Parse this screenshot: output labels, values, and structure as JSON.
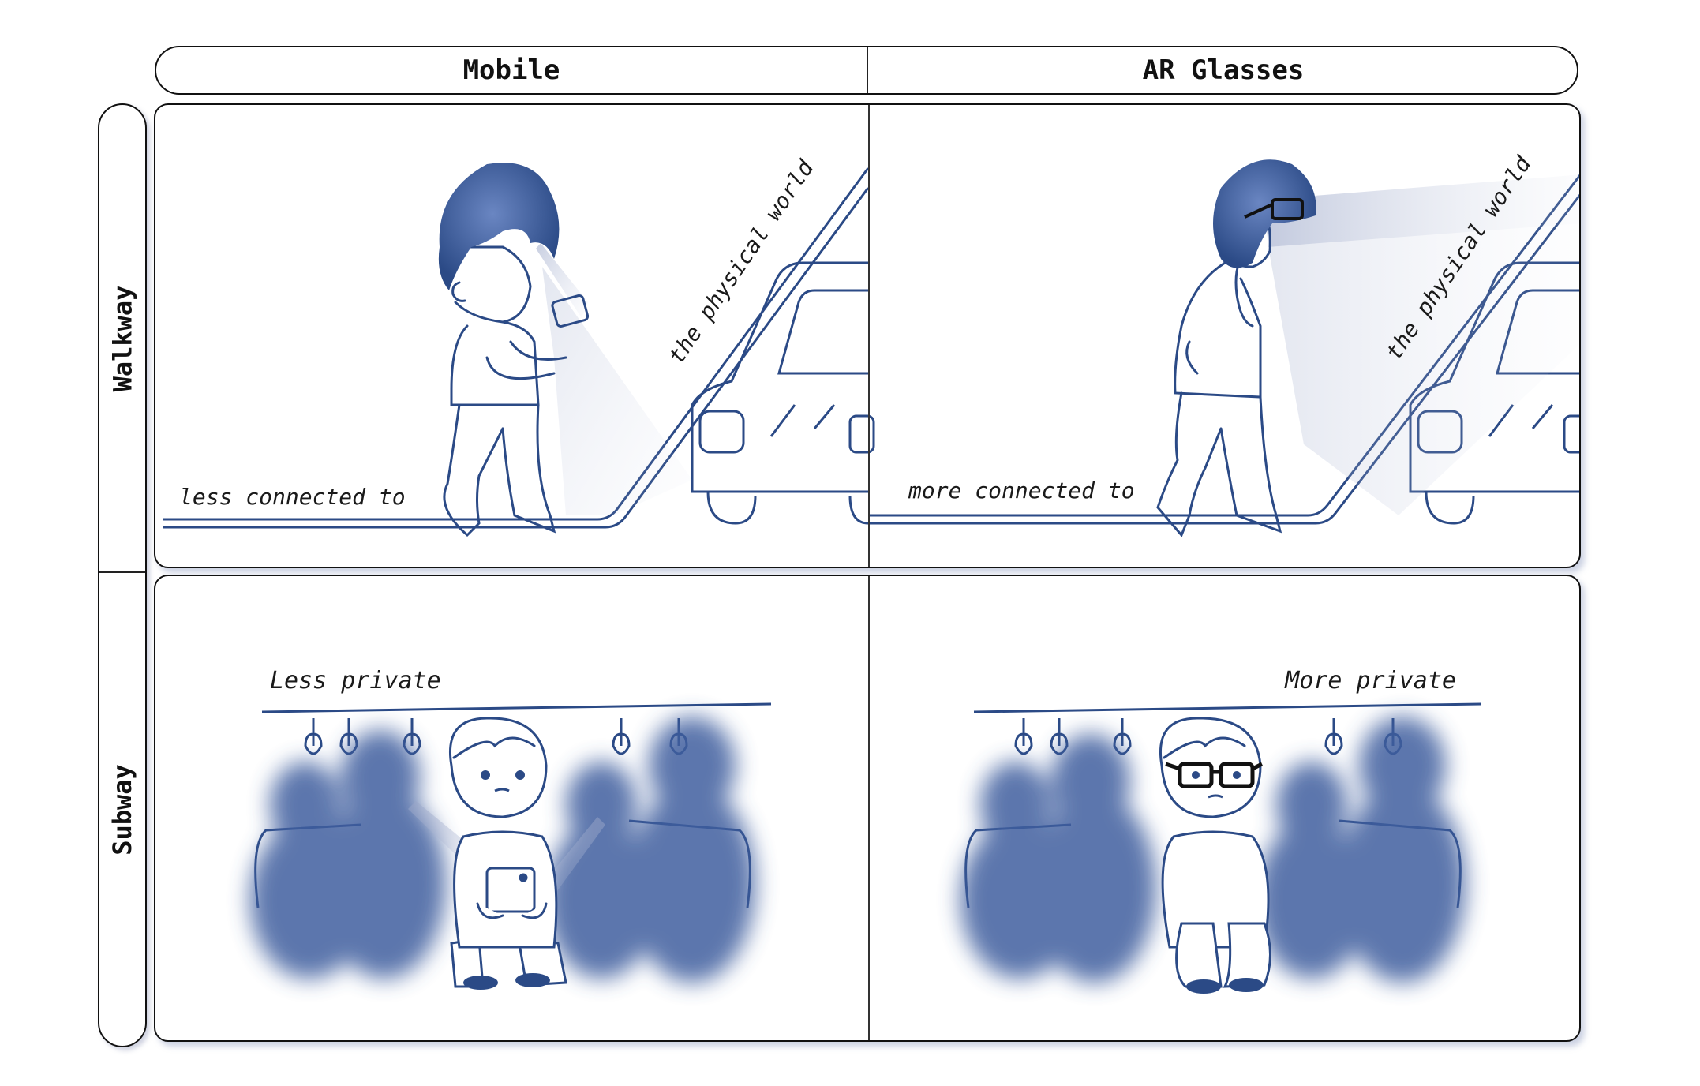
{
  "columns": {
    "mobile": "Mobile",
    "ar": "AR Glasses"
  },
  "rows": {
    "walkway": "Walkway",
    "subway": "Subway"
  },
  "walkway": {
    "mobile_caption_left": "less connected to",
    "mobile_caption_right": "the physical world",
    "ar_caption_left": "more connected to",
    "ar_caption_right": "the physical world"
  },
  "subway": {
    "mobile_caption": "Less private",
    "ar_caption": "More private"
  },
  "colors": {
    "ink": "#2b4a86",
    "hair": "#3a5a9a",
    "blur": "#3f5f9f",
    "border": "#111111"
  }
}
